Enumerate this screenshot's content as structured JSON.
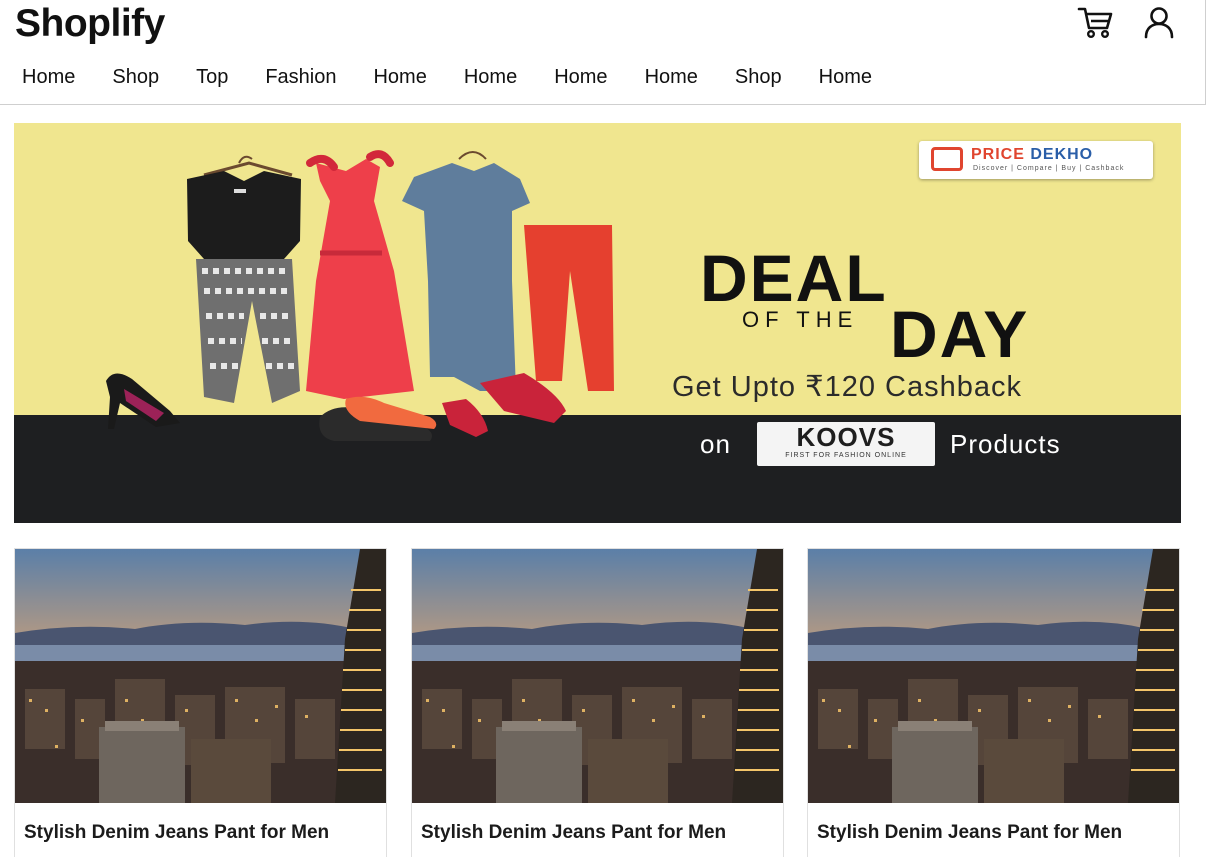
{
  "header": {
    "brand": "Shoplify",
    "icons": [
      "cart-icon",
      "user-icon"
    ],
    "nav": [
      "Home",
      "Shop",
      "Top",
      "Fashion",
      "Home",
      "Home",
      "Home",
      "Home",
      "Shop",
      "Home"
    ]
  },
  "banner": {
    "logo_brand_left": "PRICE ",
    "logo_brand_right": "DEKHO",
    "logo_tagline": "Discover | Compare | Buy | Cashback",
    "headline_top": "DEAL",
    "headline_mid": "OF THE",
    "headline_bottom": "DAY",
    "offer": "Get Upto ₹120 Cashback",
    "on_label": "on",
    "partner_name": "KOOVS",
    "partner_tagline": "FIRST FOR FASHION ONLINE",
    "products_label": "Products",
    "colors": {
      "background": "#f0e68f",
      "band": "#1e1f21"
    }
  },
  "products": [
    {
      "title": "Stylish Denim Jeans Pant for Men"
    },
    {
      "title": "Stylish Denim Jeans Pant for Men"
    },
    {
      "title": "Stylish Denim Jeans Pant for Men"
    }
  ]
}
